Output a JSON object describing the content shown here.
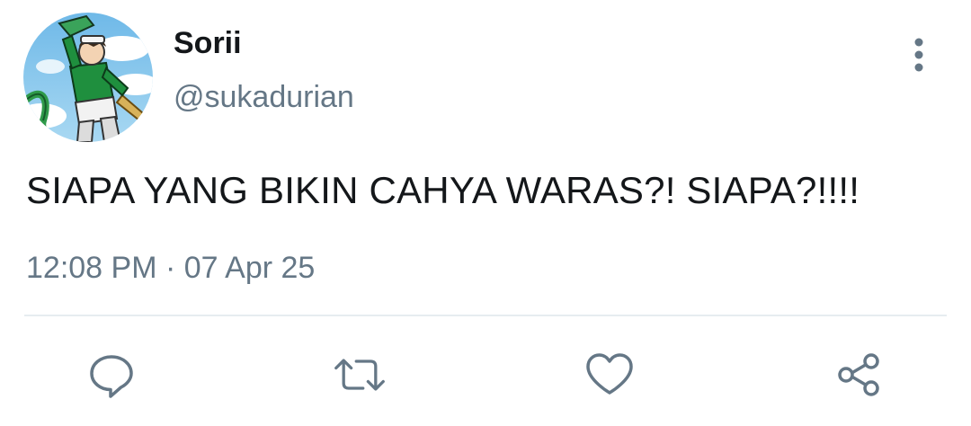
{
  "user": {
    "display_name": "Sorii",
    "handle": "@sukadurian",
    "avatar_icon": "avatar-anime-character"
  },
  "tweet": {
    "text": "SIAPA YANG BIKIN CAHYA WARAS?! SIAPA?!!!!",
    "time": "12:08 PM",
    "separator": "·",
    "date": "07 Apr 25"
  },
  "actions": {
    "reply_icon": "reply-icon",
    "retweet_icon": "retweet-icon",
    "like_icon": "heart-icon",
    "share_icon": "share-icon",
    "more_icon": "more-vertical-icon"
  },
  "colors": {
    "text_primary": "#14171a",
    "text_secondary": "#657786",
    "icon": "#657786",
    "divider": "#e6ecf0"
  }
}
